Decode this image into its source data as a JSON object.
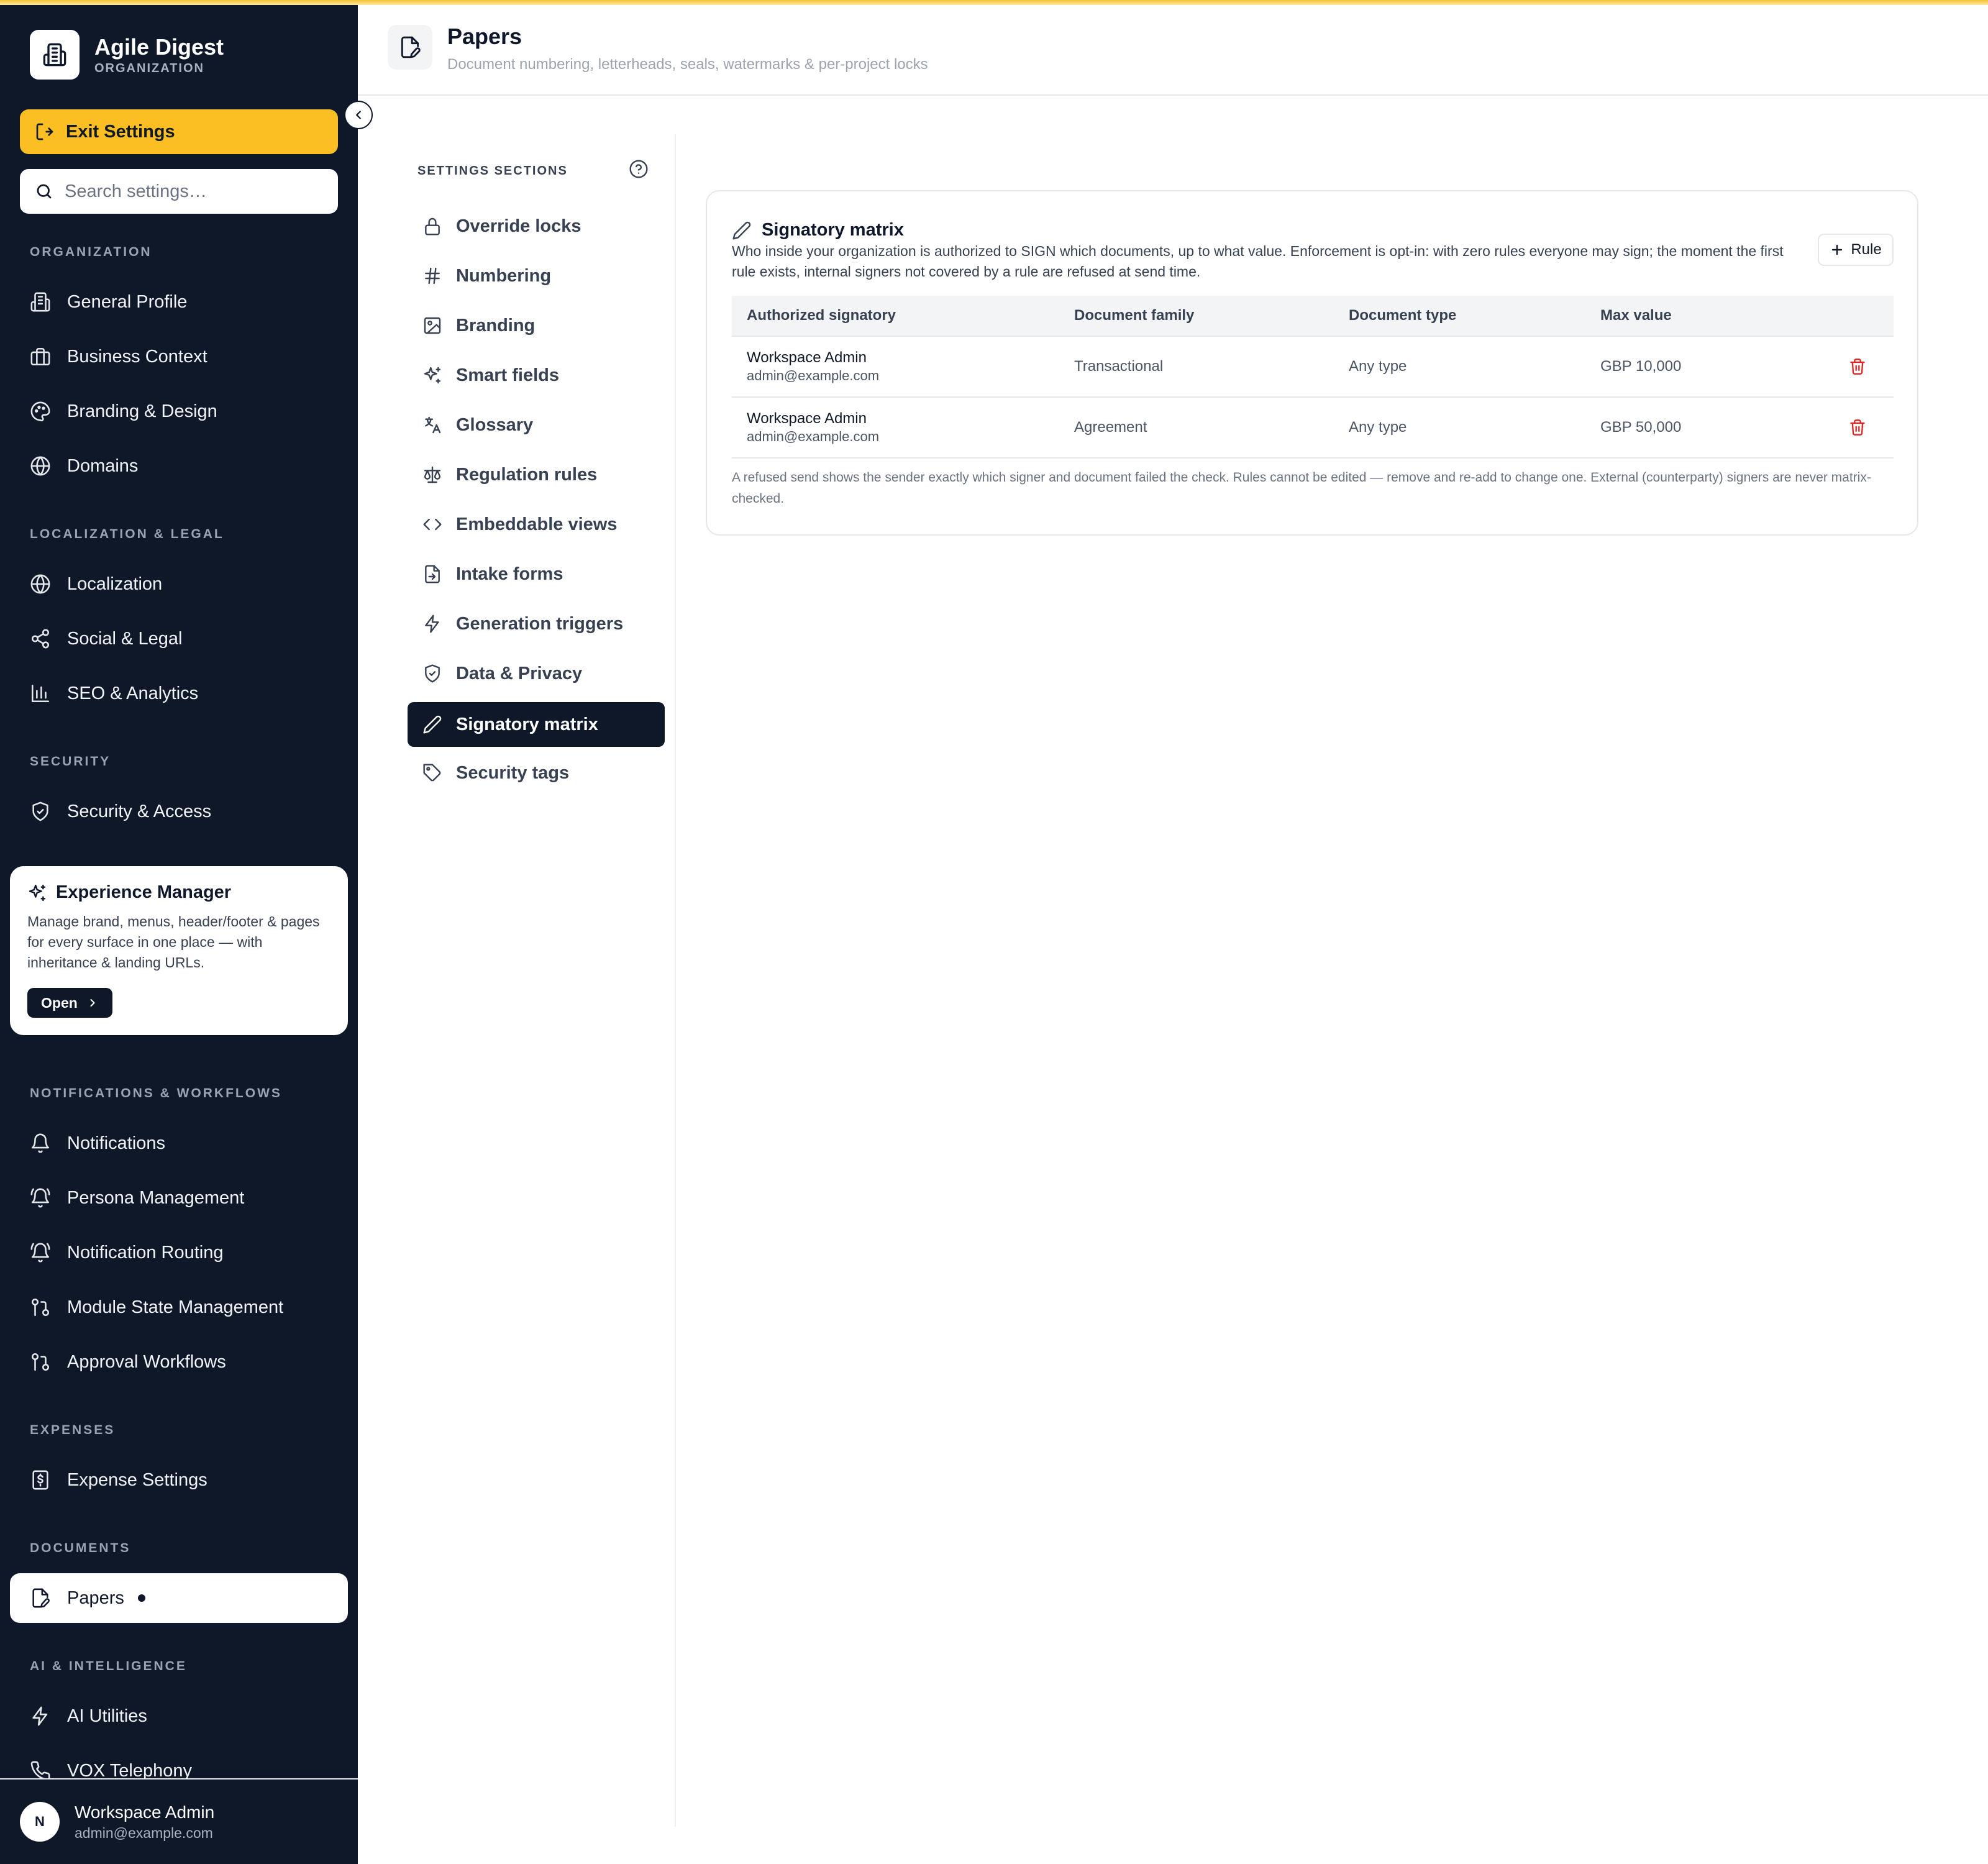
{
  "sidebar": {
    "brand": {
      "name": "Agile Digest",
      "subtitle": "ORGANIZATION"
    },
    "exit_label": "Exit Settings",
    "search_placeholder": "Search settings…",
    "sections": {
      "organization": "ORGANIZATION",
      "localization": "LOCALIZATION & LEGAL",
      "security": "SECURITY",
      "notifications": "NOTIFICATIONS & WORKFLOWS",
      "expenses": "EXPENSES",
      "documents": "DOCUMENTS",
      "ai": "AI & INTELLIGENCE"
    },
    "items": {
      "general_profile": "General Profile",
      "business_context": "Business Context",
      "branding_design": "Branding & Design",
      "domains": "Domains",
      "localization": "Localization",
      "social_legal": "Social & Legal",
      "seo_analytics": "SEO & Analytics",
      "security_access": "Security & Access",
      "notifications": "Notifications",
      "persona_management": "Persona Management",
      "notification_routing": "Notification Routing",
      "module_state": "Module State Management",
      "approval_workflows": "Approval Workflows",
      "expense_settings": "Expense Settings",
      "papers": "Papers",
      "ai_utilities": "AI Utilities",
      "vox_telephony": "VOX Telephony"
    },
    "experience_card": {
      "title": "Experience Manager",
      "description": "Manage brand, menus, header/footer & pages for every surface in one place — with inheritance & landing URLs.",
      "open_label": "Open"
    },
    "user": {
      "initial": "N",
      "name": "Workspace Admin",
      "email": "admin@example.com"
    }
  },
  "header": {
    "title": "Papers",
    "subtitle": "Document numbering, letterheads, seals, watermarks & per-project locks"
  },
  "sections_panel": {
    "heading": "SETTINGS SECTIONS",
    "items": [
      {
        "label": "Override locks",
        "icon": "lock-icon"
      },
      {
        "label": "Numbering",
        "icon": "hash-icon"
      },
      {
        "label": "Branding",
        "icon": "image-icon"
      },
      {
        "label": "Smart fields",
        "icon": "sparkles-icon"
      },
      {
        "label": "Glossary",
        "icon": "translate-icon"
      },
      {
        "label": "Regulation rules",
        "icon": "scale-icon"
      },
      {
        "label": "Embeddable views",
        "icon": "code-icon"
      },
      {
        "label": "Intake forms",
        "icon": "file-input-icon"
      },
      {
        "label": "Generation triggers",
        "icon": "bolt-icon"
      },
      {
        "label": "Data & Privacy",
        "icon": "shield-icon"
      },
      {
        "label": "Signatory matrix",
        "icon": "pen-icon",
        "active": true
      },
      {
        "label": "Security tags",
        "icon": "tag-icon"
      }
    ]
  },
  "card": {
    "title": "Signatory matrix",
    "description": "Who inside your organization is authorized to SIGN which documents, up to what value. Enforcement is opt-in: with zero rules everyone may sign; the moment the first rule exists, internal signers not covered by a rule are refused at send time.",
    "add_rule_label": "Rule",
    "columns": [
      "Authorized signatory",
      "Document family",
      "Document type",
      "Max value"
    ],
    "rows": [
      {
        "name": "Workspace Admin",
        "email": "admin@example.com",
        "family": "Transactional",
        "type": "Any type",
        "max": "GBP 10,000"
      },
      {
        "name": "Workspace Admin",
        "email": "admin@example.com",
        "family": "Agreement",
        "type": "Any type",
        "max": "GBP 50,000"
      }
    ],
    "footnote": "A refused send shows the sender exactly which signer and document failed the check. Rules cannot be edited — remove and re-add to change one. External (counterparty) signers are never matrix-checked."
  },
  "colors": {
    "sidebar_bg": "#0f1829",
    "accent": "#fbbf24",
    "danger": "#dc2626"
  }
}
